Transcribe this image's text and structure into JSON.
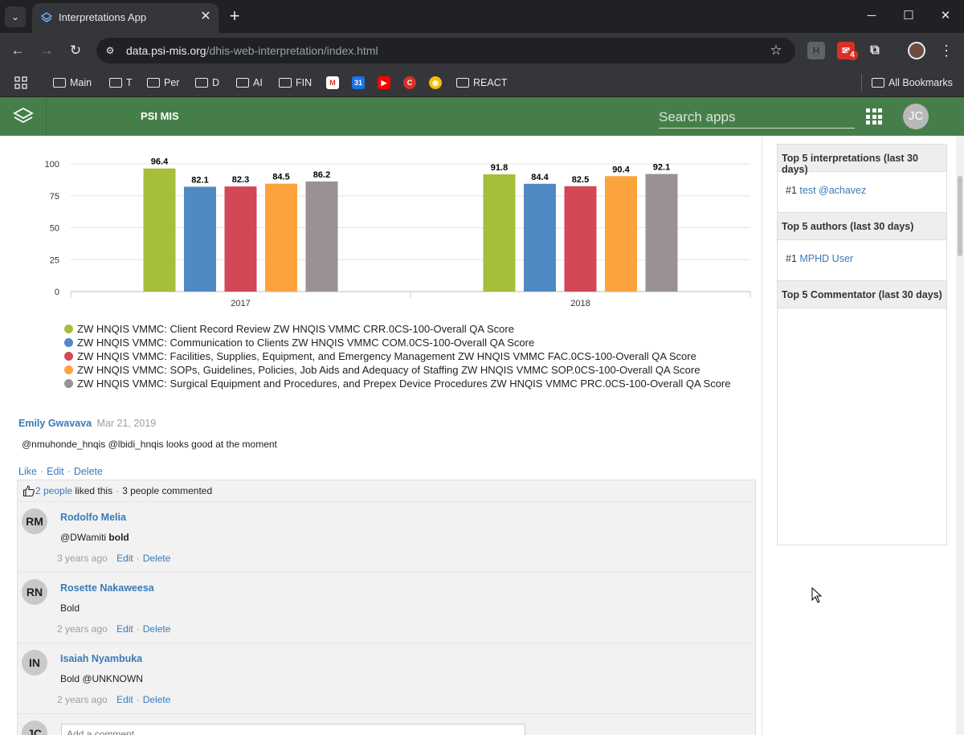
{
  "browser": {
    "tab_title": "Interpretations App",
    "url_host": "data.psi-mis.org",
    "url_path": "/dhis-web-interpretation/index.html",
    "extension_badge": "4",
    "bookmarks": [
      "Main",
      "T",
      "Per",
      "D",
      "AI",
      "FIN",
      "REACT"
    ],
    "all_bookmarks": "All Bookmarks"
  },
  "app": {
    "title": "PSI MIS",
    "search_placeholder": "Search apps",
    "user_initials": "JC",
    "brand_color": "#467e4a"
  },
  "chart_data": {
    "type": "bar",
    "categories": [
      "2017",
      "2018"
    ],
    "ylim": [
      0,
      100
    ],
    "yticks": [
      0,
      25,
      50,
      75,
      100
    ],
    "series": [
      {
        "name": "ZW HNQIS VMMC: Client Record Review ZW HNQIS VMMC CRR.0CS-100-Overall QA Score",
        "color": "#a5bf3a",
        "values": [
          96.4,
          91.8
        ]
      },
      {
        "name": "ZW HNQIS VMMC: Communication to Clients ZW HNQIS VMMC COM.0CS-100-Overall QA Score",
        "color": "#5189c4",
        "values": [
          82.1,
          84.4
        ]
      },
      {
        "name": "ZW HNQIS VMMC: Facilities, Supplies, Equipment, and Emergency Management ZW HNQIS VMMC FAC.0CS-100-Overall QA Score",
        "color": "#d34756",
        "values": [
          82.3,
          82.5
        ]
      },
      {
        "name": "ZW HNQIS VMMC: SOPs, Guidelines, Policies, Job Aids and Adequacy of Staffing ZW HNQIS VMMC SOP.0CS-100-Overall QA Score",
        "color": "#fda33e",
        "values": [
          84.5,
          90.4
        ]
      },
      {
        "name": "ZW HNQIS VMMC: Surgical Equipment and Procedures, and Prepex Device Procedures ZW HNQIS VMMC PRC.0CS-100-Overall QA Score",
        "color": "#9a9292",
        "values": [
          86.2,
          92.1
        ]
      }
    ]
  },
  "interpretation": {
    "author": "Emily Gwavava",
    "date": "Mar 21, 2019",
    "text": "@nmuhonde_hnqis @lbidi_hnqis looks good at the moment",
    "actions": {
      "like": "Like",
      "edit": "Edit",
      "delete": "Delete"
    },
    "likes_link": "2 people",
    "likes_suffix": "liked this",
    "comment_count_text": "3 people commented",
    "comments": [
      {
        "initials": "RM",
        "name": "Rodolfo Melia",
        "text_prefix": "@DWamiti",
        "text_bold": "bold",
        "time": "3 years ago",
        "edit": "Edit",
        "delete": "Delete"
      },
      {
        "initials": "RN",
        "name": "Rosette Nakaweesa",
        "text_prefix": "Bold",
        "text_bold": "",
        "time": "2 years ago",
        "edit": "Edit",
        "delete": "Delete"
      },
      {
        "initials": "IN",
        "name": "Isaiah Nyambuka",
        "text_prefix": "Bold @UNKNOWN",
        "text_bold": "",
        "time": "2 years ago",
        "edit": "Edit",
        "delete": "Delete"
      }
    ],
    "new_comment_initials": "JC",
    "add_comment_placeholder": "Add a comment..."
  },
  "sidebar": {
    "top_interpretations_title": "Top 5 interpretations (last 30 days)",
    "top_interpretations": [
      {
        "rank": "#1",
        "label": "test @achavez"
      }
    ],
    "top_authors_title": "Top 5 authors (last 30 days)",
    "top_authors": [
      {
        "rank": "#1",
        "label": "MPHD User"
      }
    ],
    "top_commentators_title": "Top 5 Commentator (last 30 days)"
  }
}
